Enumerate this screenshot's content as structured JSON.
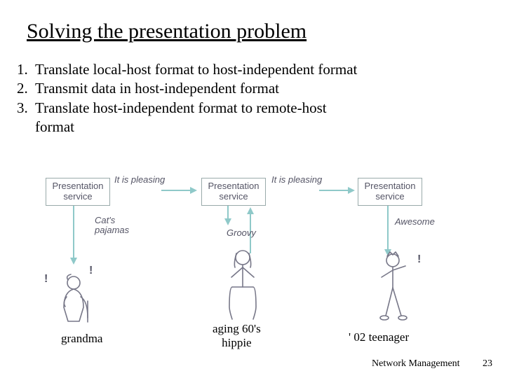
{
  "title": "Solving the presentation problem",
  "list": {
    "n1": "1.",
    "t1": "Translate local-host format to host-independent format",
    "n2": "2.",
    "t2": "Transmit data in host-independent format",
    "n3": "3.",
    "t3": "Translate host-independent format to remote-host",
    "t3b": "format"
  },
  "boxes": {
    "p": "Presentation\nservice"
  },
  "pleasings": {
    "p": "It is pleasing"
  },
  "labels": {
    "cats": "Cat's\npajamas",
    "groovy": "Groovy",
    "awesome": "Awesome"
  },
  "captions": {
    "grandma": "grandma",
    "hippie": "aging 60's\nhippie",
    "teen": "' 02 teenager"
  },
  "footer": "Network Management",
  "page": "23",
  "excl": "!"
}
